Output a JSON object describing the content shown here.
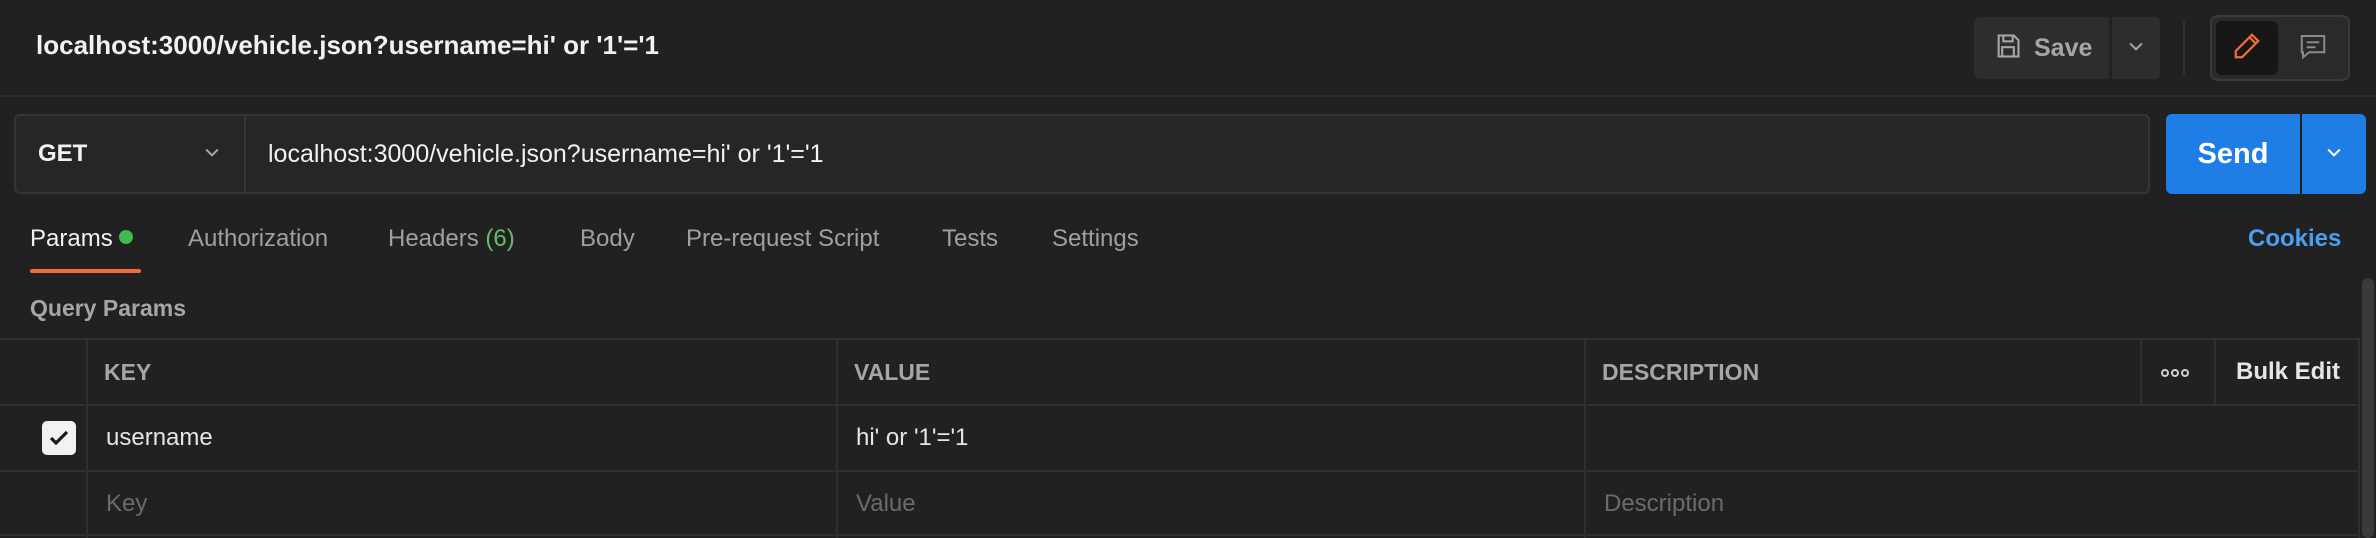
{
  "header": {
    "request_title": "localhost:3000/vehicle.json?username=hi' or '1'='1",
    "save_label": "Save"
  },
  "request": {
    "method": "GET",
    "url": "localhost:3000/vehicle.json?username=hi' or '1'='1",
    "send_label": "Send"
  },
  "tabs": {
    "params": "Params",
    "authorization": "Authorization",
    "headers": "Headers",
    "headers_count": "(6)",
    "body": "Body",
    "pre_request": "Pre-request Script",
    "tests": "Tests",
    "settings": "Settings",
    "active": "Params"
  },
  "cookies_label": "Cookies",
  "query_params": {
    "label": "Query Params",
    "columns": {
      "key": "KEY",
      "value": "VALUE",
      "description": "DESCRIPTION",
      "bulk_edit": "Bulk Edit"
    },
    "rows": [
      {
        "enabled": true,
        "key": "username",
        "value": "hi' or '1'='1",
        "description": ""
      }
    ],
    "new_row": {
      "key_placeholder": "Key",
      "value_placeholder": "Value",
      "description_placeholder": "Description"
    }
  },
  "colors": {
    "send": "#1f7ee6",
    "active_tab_underline": "#f26b3a",
    "params_dot": "#3fb950",
    "cookies_link": "#4b9ff2"
  },
  "icons": {
    "save": "save-disk-icon",
    "dropdown": "chevron-down-icon",
    "edit": "pencil-icon",
    "comments": "comment-icon",
    "more": "more-horizontal-icon",
    "checkbox": "check-icon"
  }
}
